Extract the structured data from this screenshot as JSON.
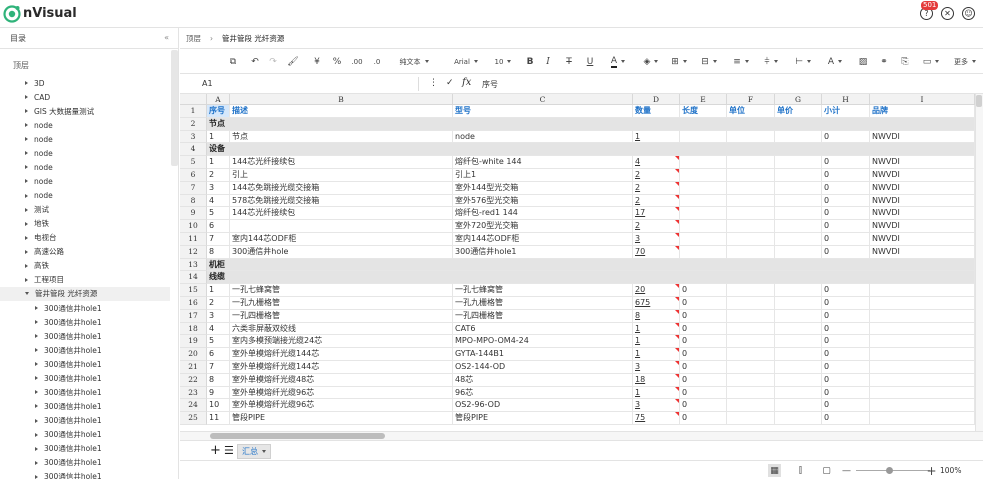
{
  "app": {
    "brand": "nVisual",
    "badge": "501"
  },
  "sidebar": {
    "title": "目录",
    "collapse_label": "«",
    "root": "顶层",
    "items": [
      {
        "label": "3D",
        "open": false
      },
      {
        "label": "CAD",
        "open": false
      },
      {
        "label": "GIS 大数据量测试",
        "open": false
      },
      {
        "label": "node",
        "open": false
      },
      {
        "label": "node",
        "open": false
      },
      {
        "label": "node",
        "open": false
      },
      {
        "label": "node",
        "open": false
      },
      {
        "label": "node",
        "open": false
      },
      {
        "label": "node",
        "open": false
      },
      {
        "label": "测试",
        "open": false
      },
      {
        "label": "地铁",
        "open": false
      },
      {
        "label": "电视台",
        "open": false
      },
      {
        "label": "高速公路",
        "open": false
      },
      {
        "label": "高铁",
        "open": false
      },
      {
        "label": "工程项目",
        "open": false
      },
      {
        "label": "管井管段 光纤资源",
        "open": true,
        "selected": true
      },
      {
        "label": "300通信井hole1",
        "open": false,
        "child": true
      },
      {
        "label": "300通信井hole1",
        "open": false,
        "child": true
      },
      {
        "label": "300通信井hole1",
        "open": false,
        "child": true
      },
      {
        "label": "300通信井hole1",
        "open": false,
        "child": true
      },
      {
        "label": "300通信井hole1",
        "open": false,
        "child": true
      },
      {
        "label": "300通信井hole1",
        "open": false,
        "child": true
      },
      {
        "label": "300通信井hole1",
        "open": false,
        "child": true
      },
      {
        "label": "300通信井hole1",
        "open": false,
        "child": true
      },
      {
        "label": "300通信井hole1",
        "open": false,
        "child": true
      },
      {
        "label": "300通信井hole1",
        "open": false,
        "child": true
      },
      {
        "label": "300通信井hole1",
        "open": false,
        "child": true
      },
      {
        "label": "300通信井hole1",
        "open": false,
        "child": true
      },
      {
        "label": "300通信井hole1",
        "open": false,
        "child": true
      }
    ]
  },
  "breadcrumb": {
    "root": "顶层",
    "sep": "›",
    "current": "管井管段 光纤资源"
  },
  "toolbar": {
    "text_format": "纯文本",
    "font": "Arial",
    "font_size": "10",
    "currency": "¥",
    "percent": "%",
    "decimal": ".00",
    "more": "更多"
  },
  "formula": {
    "cell_ref": "A1",
    "fx": "fx",
    "value": "序号"
  },
  "sheet": {
    "columns": [
      "A",
      "B",
      "C",
      "D",
      "E",
      "F",
      "G",
      "H",
      "I"
    ],
    "rows": [
      {
        "n": "1",
        "type": "hdr",
        "cells": [
          "序号",
          "描述",
          "型号",
          "数量",
          "长度",
          "单位",
          "单价",
          "小计",
          "品牌"
        ]
      },
      {
        "n": "2",
        "type": "group",
        "cells": [
          "节点",
          "",
          "",
          "",
          "",
          "",
          "",
          "",
          ""
        ]
      },
      {
        "n": "3",
        "type": "data",
        "cells": [
          "1",
          "节点",
          "node",
          "1",
          "",
          "",
          "",
          "0",
          "NWVDI"
        ]
      },
      {
        "n": "4",
        "type": "group",
        "cells": [
          "设备",
          "",
          "",
          "",
          "",
          "",
          "",
          "",
          ""
        ]
      },
      {
        "n": "5",
        "type": "data",
        "mark": true,
        "cells": [
          "1",
          "144芯光纤接续包",
          "熔纤包-white 144",
          "4",
          "",
          "",
          "",
          "0",
          "NWVDI"
        ]
      },
      {
        "n": "6",
        "type": "data",
        "mark": true,
        "cells": [
          "2",
          "引上",
          "引上1",
          "2",
          "",
          "",
          "",
          "0",
          "NWVDI"
        ]
      },
      {
        "n": "7",
        "type": "data",
        "mark": true,
        "cells": [
          "3",
          "144芯免跳接光缆交接箱",
          "室外144型光交箱",
          "2",
          "",
          "",
          "",
          "0",
          "NWVDI"
        ]
      },
      {
        "n": "8",
        "type": "data",
        "mark": true,
        "cells": [
          "4",
          "578芯免跳接光缆交接箱",
          "室外576型光交箱",
          "2",
          "",
          "",
          "",
          "0",
          "NWVDI"
        ]
      },
      {
        "n": "9",
        "type": "data",
        "mark": true,
        "cells": [
          "5",
          "144芯光纤接续包",
          "熔纤包-red1 144",
          "17",
          "",
          "",
          "",
          "0",
          "NWVDI"
        ]
      },
      {
        "n": "10",
        "type": "data",
        "mark": true,
        "cells": [
          "6",
          "",
          "室外720型光交箱",
          "2",
          "",
          "",
          "",
          "0",
          "NWVDI"
        ]
      },
      {
        "n": "11",
        "type": "data",
        "mark": true,
        "cells": [
          "7",
          "室内144芯ODF柜",
          "室内144芯ODF柜",
          "3",
          "",
          "",
          "",
          "0",
          "NWVDI"
        ]
      },
      {
        "n": "12",
        "type": "data",
        "mark": true,
        "cells": [
          "8",
          "300通信井hole",
          "300通信井hole1",
          "70",
          "",
          "",
          "",
          "0",
          "NWVDI"
        ]
      },
      {
        "n": "13",
        "type": "group",
        "cells": [
          "机柜",
          "",
          "",
          "",
          "",
          "",
          "",
          "",
          ""
        ]
      },
      {
        "n": "14",
        "type": "group",
        "cells": [
          "线缆",
          "",
          "",
          "",
          "",
          "",
          "",
          "",
          ""
        ]
      },
      {
        "n": "15",
        "type": "data",
        "mark": true,
        "cells": [
          "1",
          "一孔七蜂窝管",
          "一孔七蜂窝管",
          "20",
          "0",
          "",
          "",
          "0",
          ""
        ]
      },
      {
        "n": "16",
        "type": "data",
        "mark": true,
        "cells": [
          "2",
          "一孔九栅格管",
          "一孔九栅格管",
          "675",
          "0",
          "",
          "",
          "0",
          ""
        ]
      },
      {
        "n": "17",
        "type": "data",
        "mark": true,
        "cells": [
          "3",
          "一孔四栅格管",
          "一孔四栅格管",
          "8",
          "0",
          "",
          "",
          "0",
          ""
        ]
      },
      {
        "n": "18",
        "type": "data",
        "mark": true,
        "cells": [
          "4",
          "六类非屏蔽双绞线",
          "CAT6",
          "1",
          "0",
          "",
          "",
          "0",
          ""
        ]
      },
      {
        "n": "19",
        "type": "data",
        "mark": true,
        "cells": [
          "5",
          "室内多模预端接光缆24芯",
          "MPO-MPO-OM4-24",
          "1",
          "0",
          "",
          "",
          "0",
          ""
        ]
      },
      {
        "n": "20",
        "type": "data",
        "mark": true,
        "cells": [
          "6",
          "室外单模熔纤光缆144芯",
          "GYTA-144B1",
          "1",
          "0",
          "",
          "",
          "0",
          ""
        ]
      },
      {
        "n": "21",
        "type": "data",
        "mark": true,
        "cells": [
          "7",
          "室外单模熔纤光缆144芯",
          "OS2-144-OD",
          "3",
          "0",
          "",
          "",
          "0",
          ""
        ]
      },
      {
        "n": "22",
        "type": "data",
        "mark": true,
        "cells": [
          "8",
          "室外单模熔纤光缆48芯",
          "48芯",
          "18",
          "0",
          "",
          "",
          "0",
          ""
        ]
      },
      {
        "n": "23",
        "type": "data",
        "mark": true,
        "cells": [
          "9",
          "室外单模熔纤光缆96芯",
          "96芯",
          "1",
          "0",
          "",
          "",
          "0",
          ""
        ]
      },
      {
        "n": "24",
        "type": "data",
        "mark": true,
        "cells": [
          "10",
          "室外单模熔纤光缆96芯",
          "OS2-96-OD",
          "3",
          "0",
          "",
          "",
          "0",
          ""
        ]
      },
      {
        "n": "25",
        "type": "data",
        "mark": true,
        "cells": [
          "11",
          "管段PIPE",
          "管段PIPE",
          "75",
          "0",
          "",
          "",
          "0",
          ""
        ]
      }
    ]
  },
  "tabs": {
    "add": "+",
    "menu": "☰",
    "sheet_name": "汇总"
  },
  "status": {
    "zoom": "100%",
    "zoom_out": "—",
    "zoom_in": "+"
  }
}
